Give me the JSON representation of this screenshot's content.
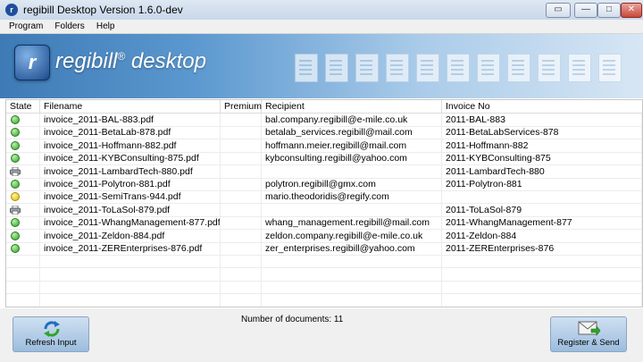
{
  "window": {
    "title": "regibill Desktop Version 1.6.0-dev",
    "app_icon_letter": "r",
    "controls": [
      "▭",
      "—",
      "□",
      "✕"
    ]
  },
  "menu": {
    "items": [
      "Program",
      "Folders",
      "Help"
    ]
  },
  "banner": {
    "logo_letter": "r",
    "brand_name": "regibill",
    "brand_mark": "®",
    "brand_suffix": " desktop"
  },
  "table": {
    "columns": [
      "State",
      "Filename",
      "Premium",
      "Recipient",
      "Invoice No"
    ],
    "rows": [
      {
        "state": "ok",
        "filename": "invoice_2011-BAL-883.pdf",
        "premium": "",
        "recipient": "bal.company.regibill@e-mile.co.uk",
        "invoice_no": "2011-BAL-883"
      },
      {
        "state": "ok",
        "filename": "invoice_2011-BetaLab-878.pdf",
        "premium": "",
        "recipient": "betalab_services.regibill@mail.com",
        "invoice_no": "2011-BetaLabServices-878"
      },
      {
        "state": "ok",
        "filename": "invoice_2011-Hoffmann-882.pdf",
        "premium": "",
        "recipient": "hoffmann.meier.regibill@mail.com",
        "invoice_no": "2011-Hoffmann-882"
      },
      {
        "state": "ok",
        "filename": "invoice_2011-KYBConsulting-875.pdf",
        "premium": "",
        "recipient": "kybconsulting.regibill@yahoo.com",
        "invoice_no": "2011-KYBConsulting-875"
      },
      {
        "state": "print",
        "filename": "invoice_2011-LambardTech-880.pdf",
        "premium": "",
        "recipient": "",
        "invoice_no": "2011-LambardTech-880"
      },
      {
        "state": "ok",
        "filename": "invoice_2011-Polytron-881.pdf",
        "premium": "",
        "recipient": "polytron.regibill@gmx.com",
        "invoice_no": "2011-Polytron-881"
      },
      {
        "state": "warn",
        "filename": "invoice_2011-SemiTrans-944.pdf",
        "premium": "",
        "recipient": "mario.theodoridis@regify.com",
        "invoice_no": ""
      },
      {
        "state": "print",
        "filename": "invoice_2011-ToLaSol-879.pdf",
        "premium": "",
        "recipient": "",
        "invoice_no": "2011-ToLaSol-879"
      },
      {
        "state": "ok",
        "filename": "invoice_2011-WhangManagement-877.pdf",
        "premium": "",
        "recipient": "whang_management.regibill@mail.com",
        "invoice_no": "2011-WhangManagement-877"
      },
      {
        "state": "ok",
        "filename": "invoice_2011-Zeldon-884.pdf",
        "premium": "",
        "recipient": "zeldon.company.regibill@e-mile.co.uk",
        "invoice_no": "2011-Zeldon-884"
      },
      {
        "state": "ok",
        "filename": "invoice_2011-ZEREnterprises-876.pdf",
        "premium": "",
        "recipient": "zer_enterprises.regibill@yahoo.com",
        "invoice_no": "2011-ZEREnterprises-876"
      }
    ]
  },
  "footer": {
    "refresh_label": "Refresh Input",
    "count_label": "Number of documents: 11",
    "send_label": "Register & Send"
  },
  "colors": {
    "ok": "#2ea52a",
    "warn": "#e0b800",
    "banner": "#3e7ab5"
  }
}
